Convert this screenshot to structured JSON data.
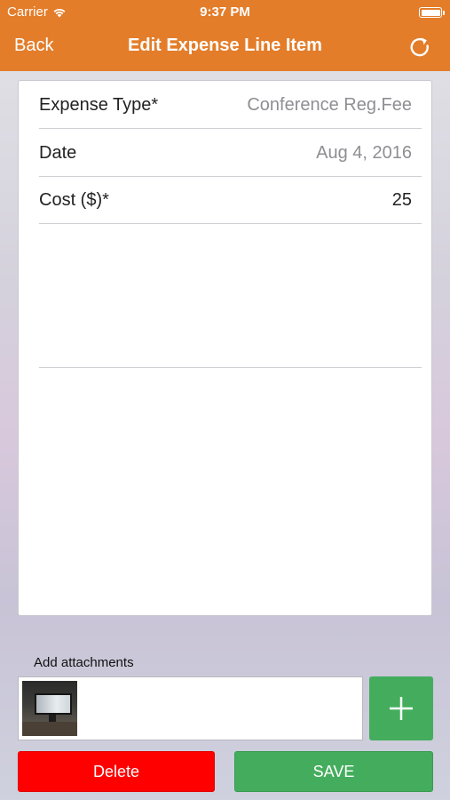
{
  "status_bar": {
    "carrier": "Carrier",
    "time": "9:37 PM"
  },
  "nav": {
    "back_label": "Back",
    "title": "Edit Expense Line Item",
    "refresh_icon": "refresh-icon"
  },
  "form": {
    "rows": [
      {
        "label": "Expense Type*",
        "value": "Conference Reg.Fee"
      },
      {
        "label": "Date",
        "value": "Aug 4, 2016"
      },
      {
        "label": "Cost ($)*",
        "value": "25"
      }
    ]
  },
  "attachments": {
    "label": "Add attachments",
    "add_icon": "plus-icon"
  },
  "actions": {
    "delete_label": "Delete",
    "save_label": "SAVE"
  },
  "colors": {
    "nav_bar": "#e37d2a",
    "delete": "#fe0000",
    "save": "#44ad5d"
  }
}
